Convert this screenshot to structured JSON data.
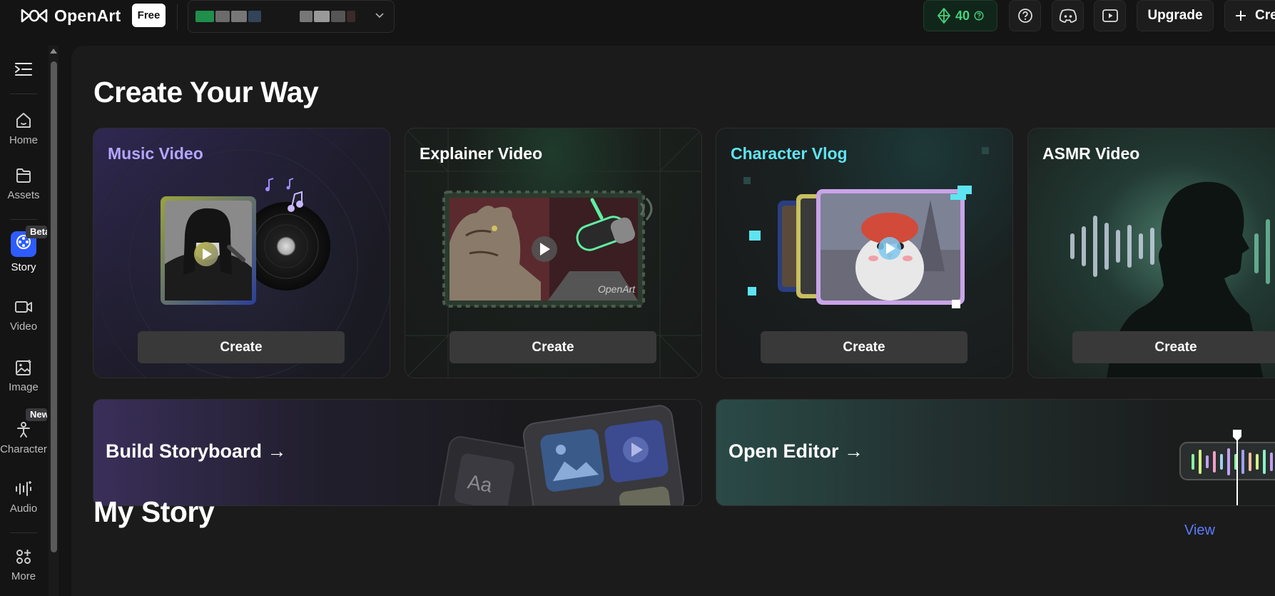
{
  "brand": {
    "name": "OpenArt",
    "plan_badge": "Free"
  },
  "header": {
    "credits": "40",
    "upgrade_label": "Upgrade",
    "create_label": "Cre"
  },
  "sidebar": {
    "items": [
      {
        "label": "Home"
      },
      {
        "label": "Assets"
      },
      {
        "label": "Story",
        "badge": "Beta"
      },
      {
        "label": "Video"
      },
      {
        "label": "Image"
      },
      {
        "label": "Character",
        "badge": "New"
      },
      {
        "label": "Audio"
      },
      {
        "label": "More"
      }
    ]
  },
  "main": {
    "create_title": "Create Your Way",
    "cards": [
      {
        "title": "Music Video",
        "title_color": "#b4a6ff",
        "button": "Create"
      },
      {
        "title": "Explainer Video",
        "title_color": "#ffffff",
        "button": "Create"
      },
      {
        "title": "Character Vlog",
        "title_color": "#5ee4f0",
        "button": "Create"
      },
      {
        "title": "ASMR Video",
        "title_color": "#ffffff",
        "button": "Create"
      }
    ],
    "banners": [
      {
        "title": "Build Storyboard →"
      },
      {
        "title": "Open Editor →"
      }
    ],
    "story_title": "My Story",
    "view_link": "View"
  },
  "colors": {
    "accent": "#2f5cff",
    "credits": "#46d27b",
    "link": "#5b7cff"
  }
}
